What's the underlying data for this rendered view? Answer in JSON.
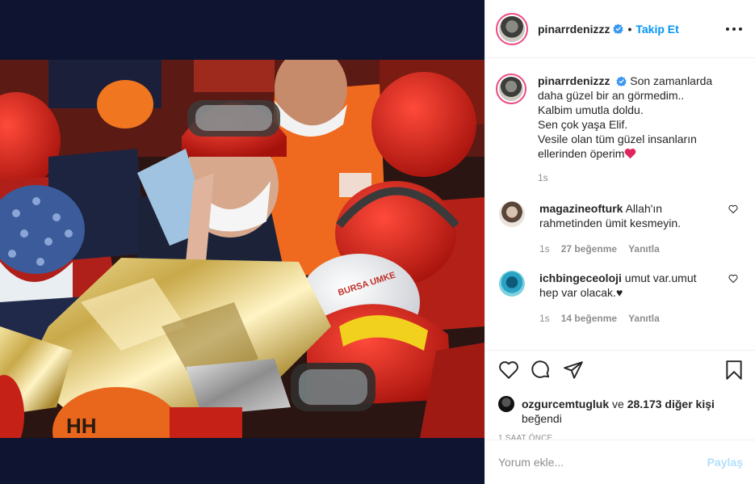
{
  "post": {
    "username": "pinarrdenizzz",
    "follow_label": "Takip Et",
    "caption_lines": [
      "Son zamanlarda daha güzel bir an görmedim..",
      "Kalbim umutla doldu.",
      "Sen çok yaşa Elif.",
      "Vesile olan tüm güzel insanların ellerinden öperim"
    ],
    "caption_time": "1s",
    "image_helmet_text": "BURSA UMKE",
    "image_hat_text": "HH"
  },
  "comments": [
    {
      "username": "magazineofturk",
      "text": "Allah'ın rahmetinden ümit kesmeyin.",
      "time": "1s",
      "likes": "27 beğenme",
      "reply": "Yanıtla"
    },
    {
      "username": "ichbingeceoloji",
      "text": "umut var.umut hep var olacak.♥",
      "time": "1s",
      "likes": "14 beğenme",
      "reply": "Yanıtla"
    }
  ],
  "likes_summary": {
    "user": "ozgurcemtugluk",
    "connector": "ve",
    "others": "28.173 diğer kişi",
    "suffix": "beğendi"
  },
  "time_ago": "1 SAAT ÖNCE",
  "add_comment": {
    "placeholder": "Yorum ekle...",
    "post_label": "Paylaş"
  },
  "icons": [
    "heart-icon",
    "comment-icon",
    "share-icon",
    "save-icon",
    "more-options-icon",
    "verified-badge-icon"
  ],
  "colors": {
    "accent": "#0095f6",
    "post_disabled": "#b2dffc",
    "media_background": "#0f1530",
    "verified": "#3897f0",
    "heart_emoji": "#e0245e"
  }
}
